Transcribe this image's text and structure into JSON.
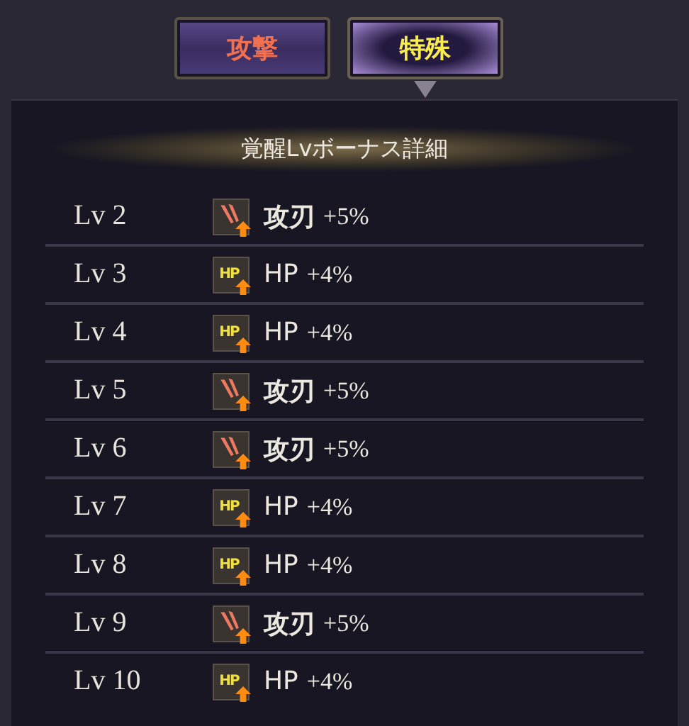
{
  "tabs": [
    {
      "label": "攻撃",
      "selected": false
    },
    {
      "label": "特殊",
      "selected": true
    }
  ],
  "panel": {
    "title": "覚醒Lvボーナス詳細",
    "rows": [
      {
        "level": "Lv 2",
        "kind": "attack",
        "name": "攻刃",
        "value": "+5%"
      },
      {
        "level": "Lv 3",
        "kind": "hp",
        "icon_text": "HP",
        "name": "HP",
        "value": "+4%"
      },
      {
        "level": "Lv 4",
        "kind": "hp",
        "icon_text": "HP",
        "name": "HP",
        "value": "+4%"
      },
      {
        "level": "Lv 5",
        "kind": "attack",
        "name": "攻刃",
        "value": "+5%"
      },
      {
        "level": "Lv 6",
        "kind": "attack",
        "name": "攻刃",
        "value": "+5%"
      },
      {
        "level": "Lv 7",
        "kind": "hp",
        "icon_text": "HP",
        "name": "HP",
        "value": "+4%"
      },
      {
        "level": "Lv 8",
        "kind": "hp",
        "icon_text": "HP",
        "name": "HP",
        "value": "+4%"
      },
      {
        "level": "Lv 9",
        "kind": "attack",
        "name": "攻刃",
        "value": "+5%"
      },
      {
        "level": "Lv 10",
        "kind": "hp",
        "icon_text": "HP",
        "name": "HP",
        "value": "+4%"
      }
    ]
  }
}
